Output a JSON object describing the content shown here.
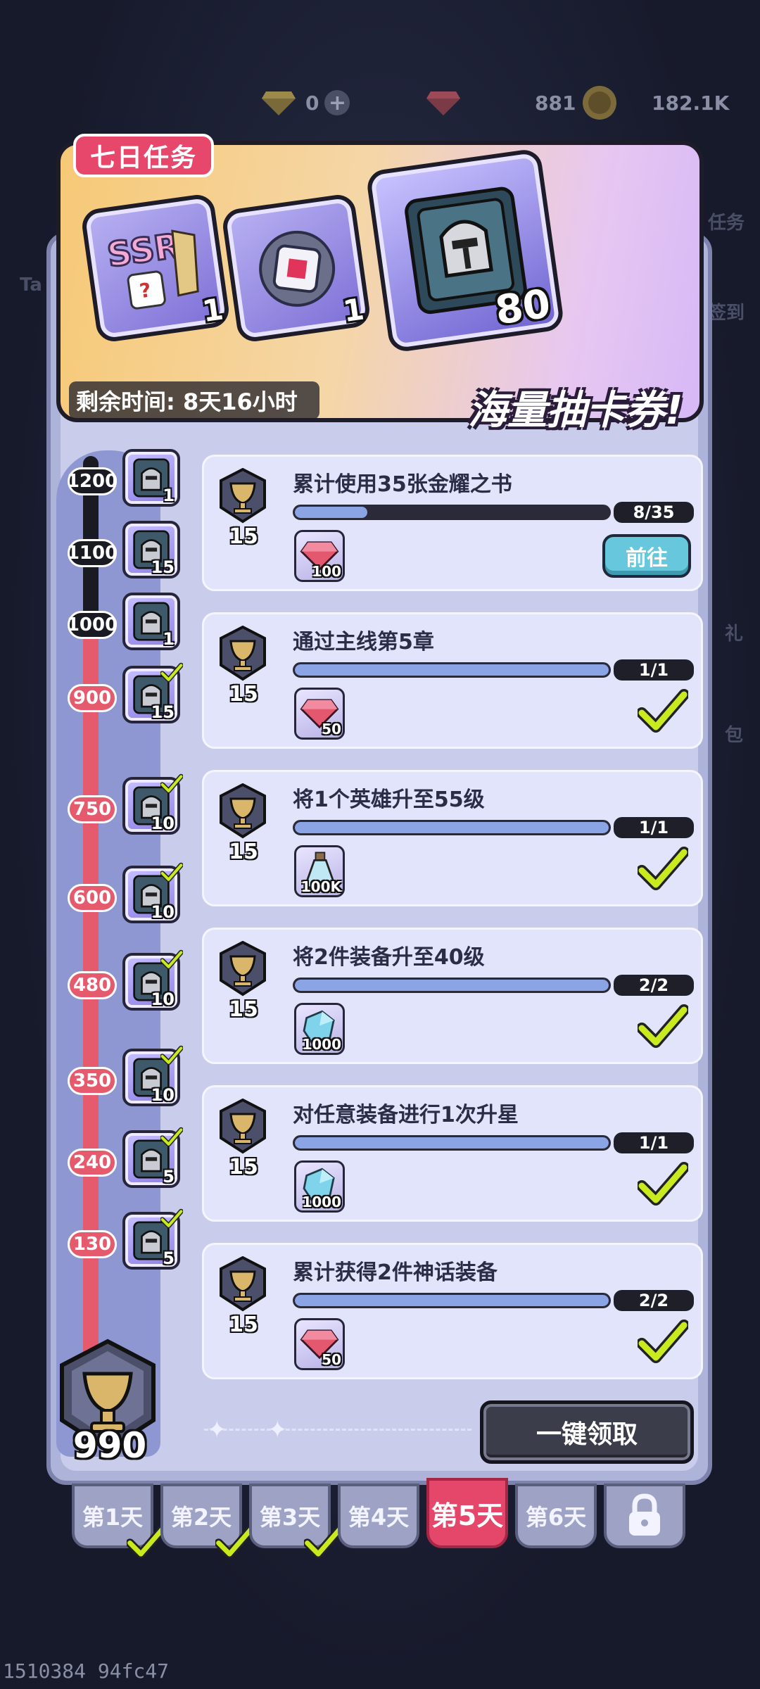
{
  "currency": {
    "gold_value": "0",
    "gem_value": "881",
    "coin_value": "182.1K"
  },
  "side_hints": {
    "right_1": "任务",
    "right_2": "签到",
    "right_3": "礼",
    "right_4": "包",
    "left_1": "Ta"
  },
  "banner": {
    "title": "七日任务",
    "reward_1_count": "1",
    "reward_2_count": "1",
    "reward_3_count": "80",
    "time_left": "剩余时间: 8天16小时",
    "slogan": "海量抽卡券!"
  },
  "milestones": [
    {
      "value": "1200",
      "reward_count": "1",
      "claimed": false
    },
    {
      "value": "1100",
      "reward_count": "15",
      "claimed": false
    },
    {
      "value": "1000",
      "reward_count": "1",
      "claimed": false
    },
    {
      "value": "900",
      "reward_count": "15",
      "claimed": true
    },
    {
      "value": "750",
      "reward_count": "10",
      "claimed": true
    },
    {
      "value": "600",
      "reward_count": "10",
      "claimed": true
    },
    {
      "value": "480",
      "reward_count": "10",
      "claimed": true
    },
    {
      "value": "350",
      "reward_count": "10",
      "claimed": true
    },
    {
      "value": "240",
      "reward_count": "5",
      "claimed": true
    },
    {
      "value": "130",
      "reward_count": "5",
      "claimed": true
    }
  ],
  "total_points": "990",
  "tasks": [
    {
      "points": "15",
      "title": "累计使用35张金耀之书",
      "progress": "8/35",
      "progress_fraction": 0.23,
      "reward_count": "100",
      "reward_type": "gem",
      "done": false,
      "go_label": "前往"
    },
    {
      "points": "15",
      "title": "通过主线第5章",
      "progress": "1/1",
      "progress_fraction": 1,
      "reward_count": "50",
      "reward_type": "gem",
      "done": true
    },
    {
      "points": "15",
      "title": "将1个英雄升至55级",
      "progress": "1/1",
      "progress_fraction": 1,
      "reward_count": "100K",
      "reward_type": "potion",
      "done": true
    },
    {
      "points": "15",
      "title": "将2件装备升至40级",
      "progress": "2/2",
      "progress_fraction": 1,
      "reward_count": "1000",
      "reward_type": "crystal",
      "done": true
    },
    {
      "points": "15",
      "title": "对任意装备进行1次升星",
      "progress": "1/1",
      "progress_fraction": 1,
      "reward_count": "1000",
      "reward_type": "crystal",
      "done": true
    },
    {
      "points": "15",
      "title": "累计获得2件神话装备",
      "progress": "2/2",
      "progress_fraction": 1,
      "reward_count": "50",
      "reward_type": "gem",
      "done": true
    }
  ],
  "claim_all_label": "一键领取",
  "day_tabs": [
    {
      "label": "第1天",
      "completed": true
    },
    {
      "label": "第2天",
      "completed": true
    },
    {
      "label": "第3天",
      "completed": true
    },
    {
      "label": "第4天",
      "completed": false
    },
    {
      "label": "第5天",
      "completed": false,
      "active": true
    },
    {
      "label": "第6天",
      "completed": false
    },
    {
      "label": "",
      "locked": true
    }
  ],
  "footer_id": "1510384 94fc47",
  "colors": {
    "accent": "#e5476a",
    "panel": "#c9cdeb",
    "go_button": "#67c7dc",
    "check": "#c8ea1e"
  }
}
